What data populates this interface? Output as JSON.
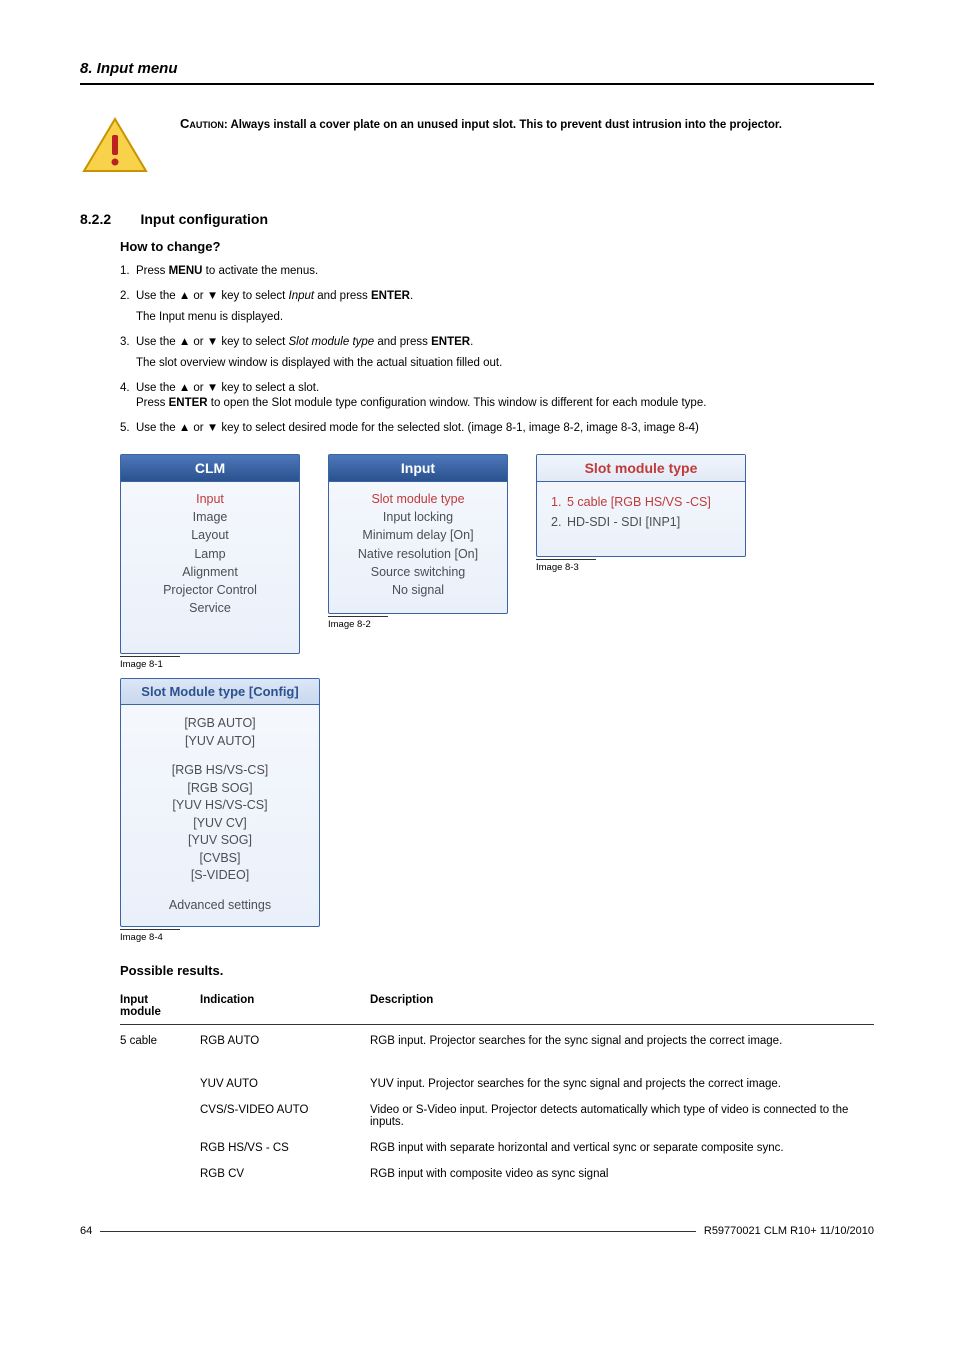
{
  "header": {
    "title": "8.  Input menu"
  },
  "caution": {
    "label": "Caution",
    "text": ": Always install a cover plate on an unused input slot.  This to prevent dust intrusion into the projector."
  },
  "section": {
    "number": "8.2.2",
    "title": "Input configuration",
    "subhead": "How to change?"
  },
  "steps": {
    "s1_a": "Press ",
    "s1_b": "MENU",
    "s1_c": " to activate the menus.",
    "s2_a": "Use the ▲ or ▼ key to select ",
    "s2_b": "Input",
    "s2_c": " and press ",
    "s2_d": "ENTER",
    "s2_e": ".",
    "s2_sub": "The Input menu is displayed.",
    "s3_a": "Use the ▲ or ▼ key to select ",
    "s3_b": "Slot module type",
    "s3_c": " and press ",
    "s3_d": "ENTER",
    "s3_e": ".",
    "s3_sub": "The slot overview window is displayed with the actual situation filled out.",
    "s4_a": "Use the ▲ or ▼ key to select a slot.",
    "s4_b": "Press ",
    "s4_c": "ENTER",
    "s4_d": " to open the Slot module type configuration window.  This window is different for each module type.",
    "s5": "Use the ▲ or ▼ key to select desired mode for the selected slot.  (image 8-1, image 8-2, image 8-3, image 8-4)"
  },
  "menus": {
    "m1": {
      "title": "CLM",
      "selected": "Input",
      "items": [
        "Image",
        "Layout",
        "Lamp",
        "Alignment",
        "Projector Control",
        "Service"
      ],
      "caption": "Image 8-1"
    },
    "m2": {
      "title": "Input",
      "selected": "Slot module type",
      "items": [
        "Input locking",
        "Minimum delay [On]",
        "Native resolution [On]",
        "Source switching",
        "No signal"
      ],
      "caption": "Image 8-2"
    },
    "m3": {
      "title": "Slot module type",
      "items": [
        "5 cable [RGB HS/VS -CS]",
        "HD-SDI - SDI [INP1]"
      ],
      "caption": "Image 8-3"
    },
    "m4": {
      "title": "Slot Module type [Config]",
      "group1": [
        "[RGB AUTO]",
        "[YUV AUTO]"
      ],
      "group2": [
        "[RGB HS/VS-CS]",
        "[RGB SOG]",
        "[YUV HS/VS-CS]",
        "[YUV CV]",
        "[YUV SOG]",
        "[CVBS]",
        "[S-VIDEO]"
      ],
      "group3": [
        "Advanced settings"
      ],
      "caption": "Image 8-4"
    }
  },
  "results": {
    "head": "Possible results.",
    "cols": [
      "Input module",
      "Indication",
      "Description"
    ],
    "rows": [
      {
        "mod": "5 cable",
        "ind": "RGB AUTO",
        "desc": "RGB input.  Projector searches for the sync signal and projects the correct image."
      },
      {
        "mod": "",
        "ind": "YUV AUTO",
        "desc": "YUV input.  Projector searches for the sync signal and projects the correct image."
      },
      {
        "mod": "",
        "ind": "CVS/S-VIDEO AUTO",
        "desc": "Video or S-Video input.  Projector detects automatically which type of video is connected to the inputs."
      },
      {
        "mod": "",
        "ind": "RGB HS/VS - CS",
        "desc": "RGB input with separate horizontal and vertical sync or separate composite sync."
      },
      {
        "mod": "",
        "ind": "RGB CV",
        "desc": "RGB input with composite video as sync signal"
      }
    ]
  },
  "footer": {
    "page": "64",
    "doc": "R59770021 CLM R10+ 11/10/2010"
  }
}
